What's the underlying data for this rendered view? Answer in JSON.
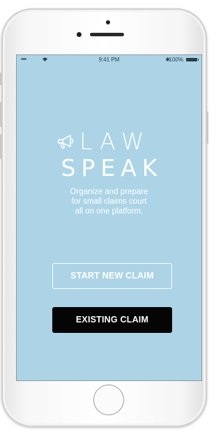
{
  "status_bar": {
    "signal": "•••••",
    "time": "9:41 PM",
    "bluetooth": "✱",
    "battery_percent": "100%"
  },
  "brand": {
    "line1": "LAW",
    "line2": "SPEAK",
    "icon": "megaphone-icon"
  },
  "tagline": {
    "line1": "Organize and prepare",
    "line2": "for small claims court",
    "line3": "all on one platform."
  },
  "buttons": {
    "start_new_claim": "START NEW CLAIM",
    "existing_claim": "EXISTING CLAIM"
  },
  "colors": {
    "screen_background": "#acd4e6",
    "primary_button": "#050505",
    "text": "#ffffff"
  }
}
